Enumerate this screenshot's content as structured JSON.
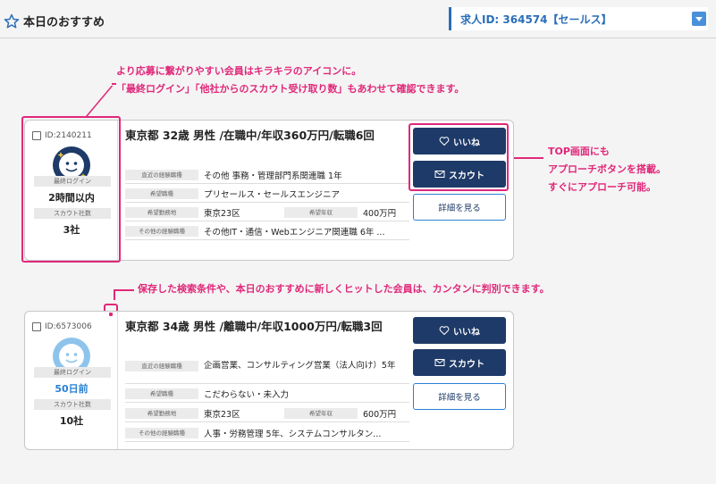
{
  "header": {
    "title": "本日のおすすめ",
    "job_select": "求人ID: 364574【セールス】"
  },
  "annotations": {
    "top_line1": "より応募に繋がりやすい会員はキラキラのアイコンに。",
    "top_line2": "「最終ログイン」「他社からのスカウト受け取り数」もあわせて確認できます。",
    "right_line1": "TOP画面にも",
    "right_line2": "アプローチボタンを搭載。",
    "right_line3": "すぐにアプローチ可能。",
    "middle": "保存した検索条件や、本日のおすすめに新しくヒットした会員は、カンタンに判別できます。"
  },
  "labels": {
    "last_login": "最終ログイン",
    "scout_count": "スカウト社数",
    "recent_job": "直近の経験職種",
    "desired_job": "希望職種",
    "desired_area": "希望勤務地",
    "desired_salary": "希望年収",
    "other_job": "その他の経験職種"
  },
  "buttons": {
    "like": "いいね",
    "scout": "スカウト",
    "detail": "詳細を見る"
  },
  "cards": [
    {
      "id": "ID:2140211",
      "last_login": "2時間以内",
      "scout_count": "3社",
      "title": "東京都 32歳 男性 /在職中/年収360万円/転職6回",
      "recent_job": "その他 事務・管理部門系関連職 1年",
      "desired_job": "プリセールス・セールスエンジニア",
      "desired_area": "東京23区",
      "desired_salary": "400万円",
      "other_job": "その他IT・通信・Webエンジニア関連職 6年 ..."
    },
    {
      "id": "ID:6573006",
      "last_login": "50日前",
      "scout_count": "10社",
      "title": "東京都 34歳 男性 /離職中/年収1000万円/転職3回",
      "recent_job": "企画営業、コンサルティング営業（法人向け）5年",
      "desired_job": "こだわらない・未入力",
      "desired_area": "東京23区",
      "desired_salary": "600万円",
      "other_job": "人事・労務管理 5年、システムコンサルタン..."
    }
  ],
  "colors": {
    "annotation": "#e0287a",
    "navy": "#1e3a68",
    "blue": "#2a80d2"
  }
}
